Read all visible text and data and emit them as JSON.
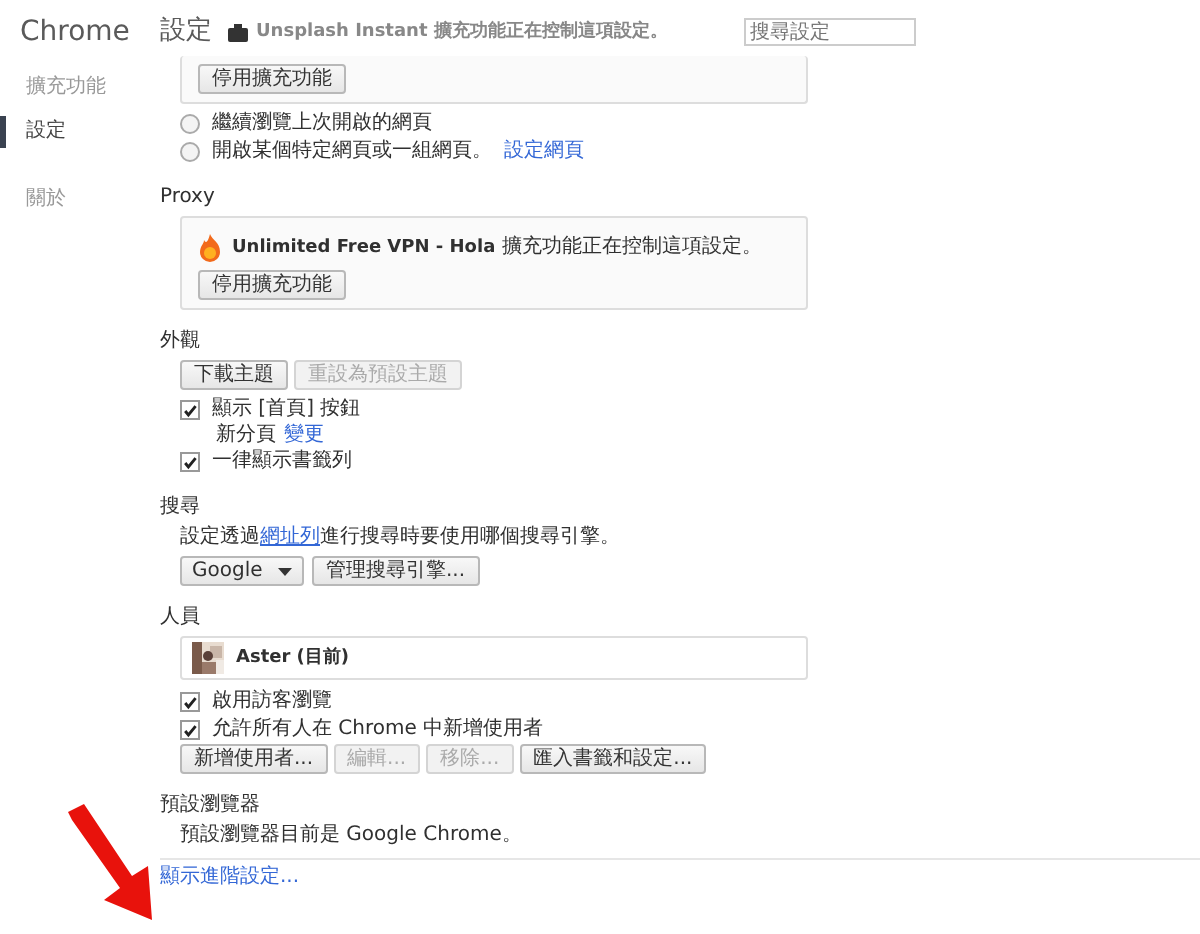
{
  "sidebar": {
    "title": "Chrome",
    "items": [
      {
        "label": "擴充功能",
        "selected": false
      },
      {
        "label": "設定",
        "selected": true
      },
      {
        "label": "關於",
        "selected": false
      }
    ]
  },
  "header": {
    "title": "設定",
    "overlay_notice": "Unsplash Instant 擴充功能正在控制這項設定。",
    "search": {
      "placeholder": "搜尋設定"
    }
  },
  "startup": {
    "card_button": "停用擴充功能",
    "options": [
      {
        "label": "繼續瀏覽上次開啟的網頁",
        "selected": false
      },
      {
        "label": "開啟某個特定網頁或一組網頁。",
        "link": "設定網頁",
        "selected": false
      }
    ]
  },
  "proxy": {
    "heading": "Proxy",
    "extension_name": "Unlimited Free VPN - Hola",
    "notice": "擴充功能正在控制這項設定。",
    "button": "停用擴充功能"
  },
  "appearance": {
    "heading": "外觀",
    "buttons": [
      {
        "label": "下載主題",
        "disabled": false
      },
      {
        "label": "重設為預設主題",
        "disabled": true
      }
    ],
    "options": [
      {
        "label": "顯示 [首頁] 按鈕",
        "checked": true,
        "sub_label": "新分頁",
        "sub_link": "變更"
      },
      {
        "label": "一律顯示書籤列",
        "checked": true
      }
    ]
  },
  "search": {
    "heading": "搜尋",
    "text_before": "設定透過",
    "link": "網址列",
    "text_after": "進行搜尋時要使用哪個搜尋引擎。",
    "engine": "Google",
    "button": "管理搜尋引擎..."
  },
  "people": {
    "heading": "人員",
    "profile": "Aster (目前)",
    "options": [
      {
        "label": "啟用訪客瀏覽",
        "checked": true
      },
      {
        "label": "允許所有人在 Chrome 中新增使用者",
        "checked": true
      }
    ],
    "buttons": [
      {
        "label": "新增使用者...",
        "disabled": false
      },
      {
        "label": "編輯...",
        "disabled": true
      },
      {
        "label": "移除...",
        "disabled": true
      },
      {
        "label": "匯入書籤和設定...",
        "disabled": false
      }
    ]
  },
  "default_browser": {
    "heading": "預設瀏覽器",
    "text": "預設瀏覽器目前是 Google Chrome。"
  },
  "advanced_link": "顯示進階設定..."
}
